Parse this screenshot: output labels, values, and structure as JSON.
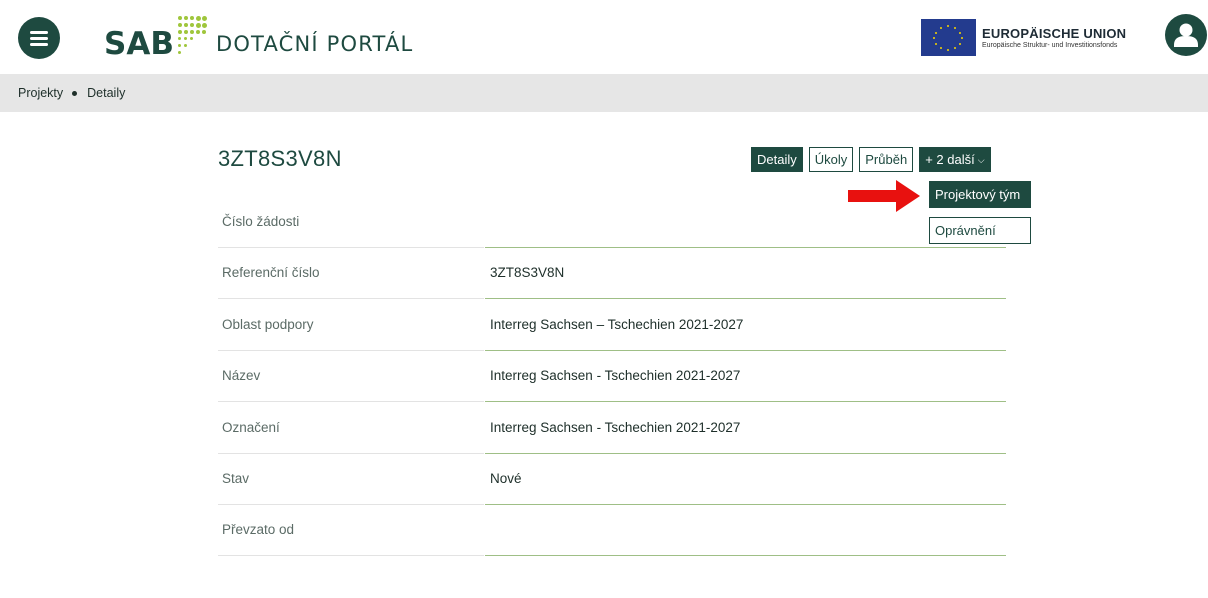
{
  "header": {
    "logo_sab": "SAB",
    "logo_portal": "DOTAČNÍ PORTÁL",
    "eu_title": "EUROPÄISCHE UNION",
    "eu_subtitle": "Europäische Struktur- und Investitionsfonds"
  },
  "breadcrumb": {
    "items": [
      "Projekty",
      "Detaily"
    ]
  },
  "project": {
    "title": "3ZT8S3V8N"
  },
  "tabs": {
    "detail": "Detaily",
    "tasks": "Úkoly",
    "progress": "Průběh",
    "more": "+ 2 další"
  },
  "dropdown": {
    "items": [
      "Projektový tým",
      "Oprávnění"
    ]
  },
  "fields": [
    {
      "label": "Číslo žádosti",
      "value": ""
    },
    {
      "label": "Referenční číslo",
      "value": "3ZT8S3V8N"
    },
    {
      "label": "Oblast podpory",
      "value": "Interreg Sachsen – Tschechien 2021-2027"
    },
    {
      "label": "Název",
      "value": "Interreg Sachsen - Tschechien 2021-2027"
    },
    {
      "label": "Označení",
      "value": "Interreg Sachsen - Tschechien 2021-2027"
    },
    {
      "label": "Stav",
      "value": "Nové"
    },
    {
      "label": "Převzato od",
      "value": ""
    }
  ],
  "colors": {
    "brand": "#1e4a40",
    "accent_dots": "#9fc63c",
    "arrow": "#e8110f",
    "eu_blue": "#233b8e"
  },
  "icons": {
    "menu": "hamburger-icon",
    "user": "user-icon",
    "arrow": "red-arrow-annotation"
  }
}
